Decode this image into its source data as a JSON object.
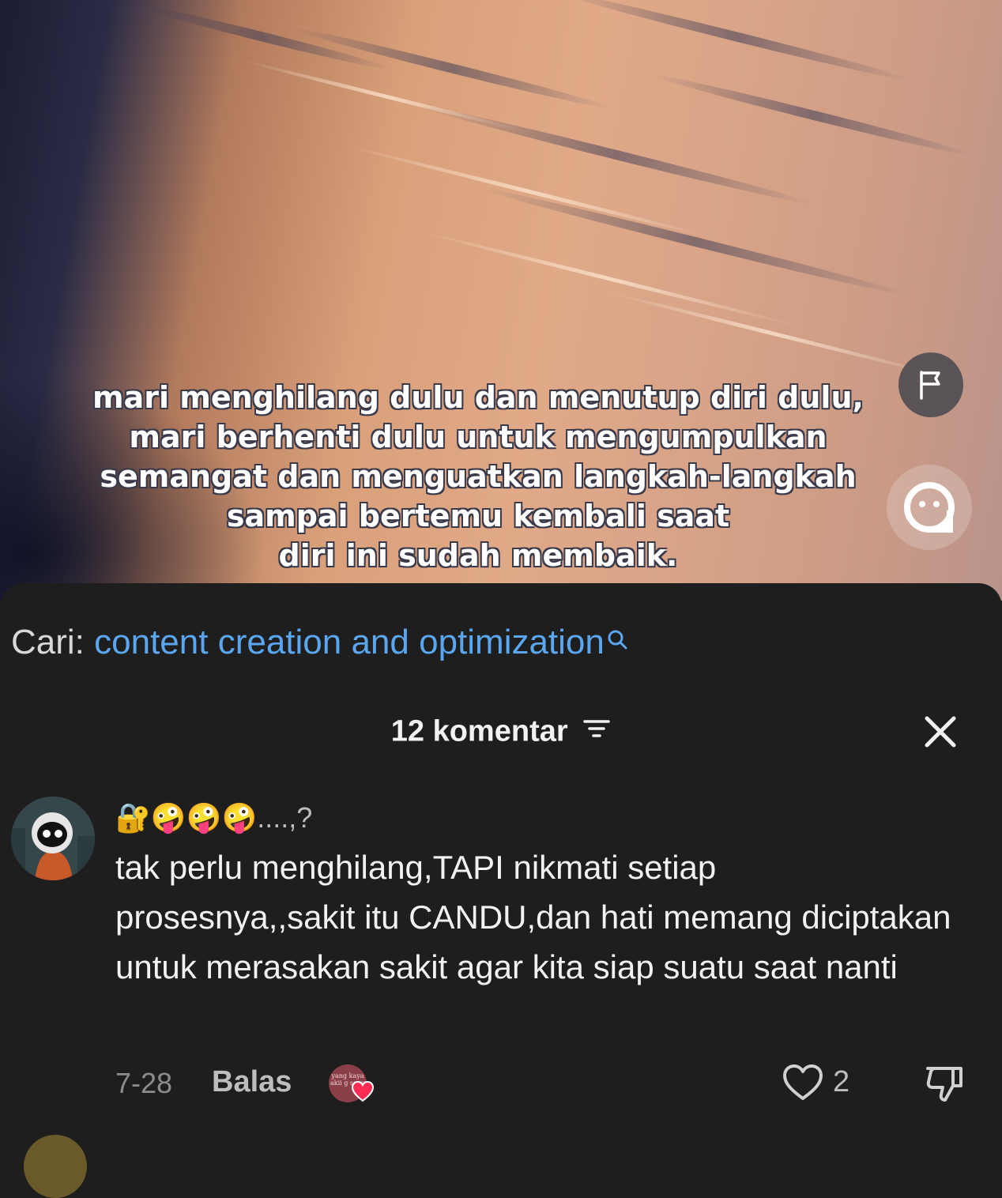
{
  "video": {
    "caption_lines": [
      "mari menghilang dulu dan menutup diri dulu,",
      "mari berhenti dulu untuk mengumpulkan",
      "semangat dan menguatkan langkah-langkah",
      "sampai bertemu kembali saat",
      "diri ini sudah membaik."
    ],
    "icons": {
      "report": "flag-icon",
      "reaction": "face-icon"
    }
  },
  "search": {
    "prefix": "Cari:",
    "term": "content creation and optimization",
    "icon": "search-icon",
    "term_color": "#5aa6f0"
  },
  "comments": {
    "header": "12 komentar",
    "icons": {
      "sort": "filter-icon",
      "close": "close-icon"
    },
    "items": [
      {
        "username": "🔐🤪🤪🤪....,?",
        "text": "tak perlu menghilang,TAPI nikmati setiap prosesnya,,sakit itu CANDU,dan hati memang diciptakan untuk merasakan sakit agar kita siap suatu saat nanti",
        "date": "7-28",
        "reply_label": "Balas",
        "creator_like_badge": "yang kaya akii g sepu",
        "like_count": "2",
        "icons": {
          "like": "heart-outline-icon",
          "dislike": "thumbs-down-icon",
          "creator_liked": "heart-icon"
        }
      }
    ]
  }
}
